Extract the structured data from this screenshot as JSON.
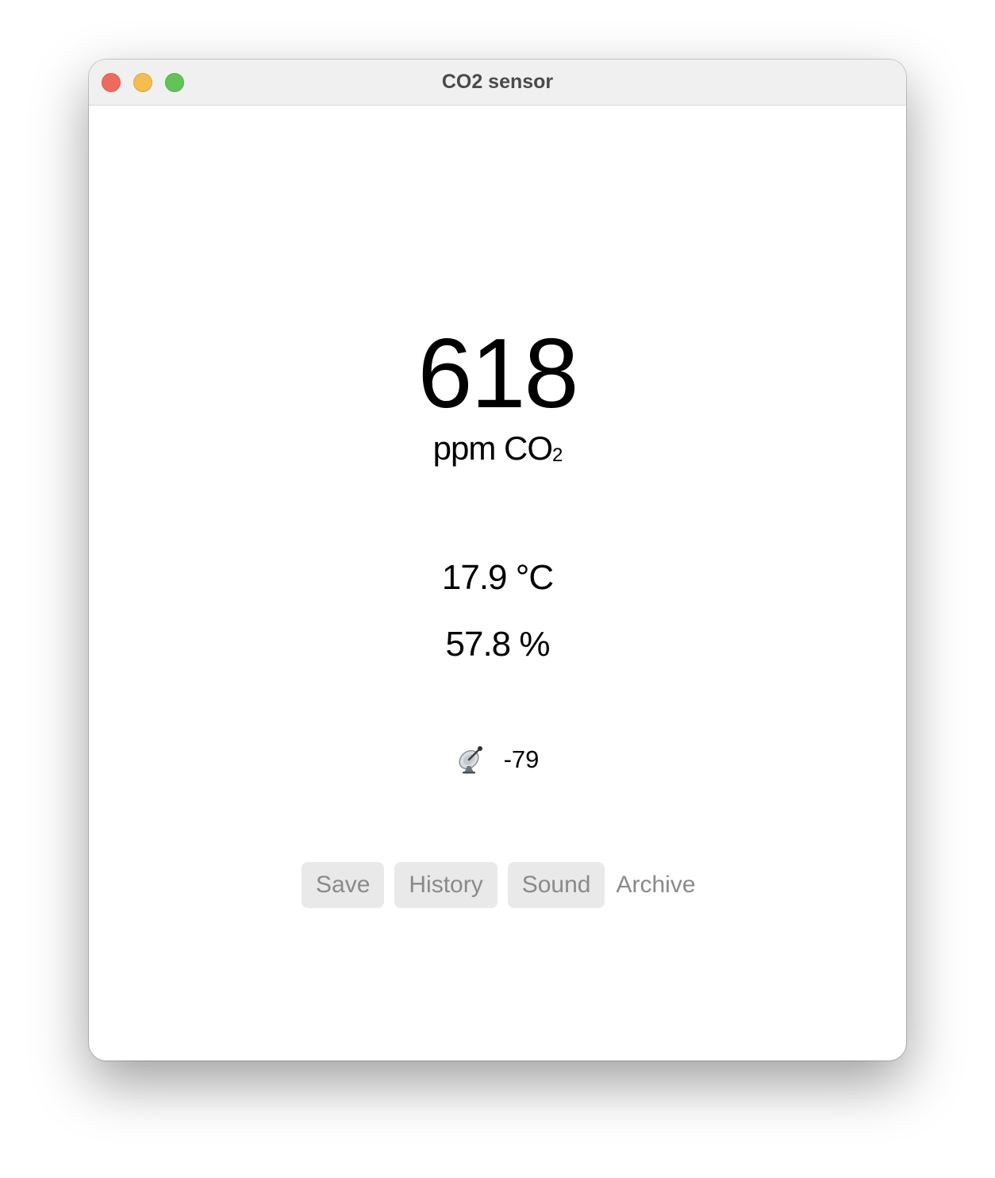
{
  "window": {
    "title": "CO2 sensor",
    "controls": [
      "close",
      "minimize",
      "zoom"
    ]
  },
  "reading": {
    "co2_value": "618",
    "co2_unit": "ppm CO",
    "co2_unit_subscript": "2",
    "temperature": "17.9 °C",
    "humidity": "57.8 %",
    "signal_icon": "satellite-antenna-icon",
    "signal_strength": "-79"
  },
  "actions": {
    "save_label": "Save",
    "history_label": "History",
    "sound_label": "Sound",
    "archive_label": "Archive"
  },
  "colors": {
    "close": "#ee6a5e",
    "minimize": "#f5bd4f",
    "zoom": "#61c454",
    "button_bg": "#e9e9e9",
    "button_text": "#8a8a8a"
  }
}
